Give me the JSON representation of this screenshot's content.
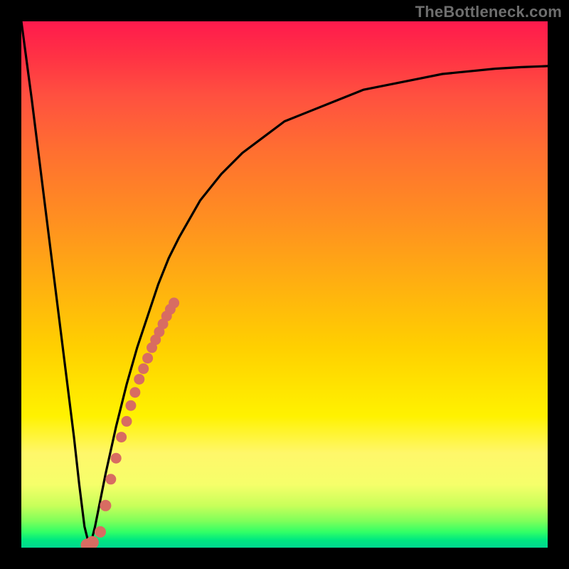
{
  "watermark": "TheBottleneck.com",
  "chart_data": {
    "type": "line",
    "title": "",
    "xlabel": "",
    "ylabel": "",
    "xlim": [
      0,
      100
    ],
    "ylim": [
      0,
      100
    ],
    "grid": false,
    "series": [
      {
        "name": "curve",
        "color": "#000000",
        "x": [
          0,
          2,
          4,
          6,
          8,
          10,
          11,
          12,
          13,
          14,
          16,
          18,
          20,
          22,
          24,
          26,
          28,
          30,
          34,
          38,
          42,
          46,
          50,
          55,
          60,
          65,
          70,
          75,
          80,
          85,
          90,
          95,
          100
        ],
        "y": [
          100,
          85,
          69,
          53,
          37,
          21,
          12,
          4,
          0,
          4,
          14,
          23,
          31,
          38,
          44,
          50,
          55,
          59,
          66,
          71,
          75,
          78,
          81,
          83,
          85,
          87,
          88,
          89,
          90,
          90.5,
          91,
          91.3,
          91.5
        ]
      },
      {
        "name": "highlight-dots",
        "color": "#d86c62",
        "x": [
          12.5,
          13.5,
          15,
          16,
          17,
          18,
          19,
          20,
          20.8,
          21.6,
          22.4,
          23.2,
          24,
          24.8,
          25.5,
          26.2,
          26.9,
          27.6,
          28.3,
          29
        ],
        "y": [
          0.5,
          1,
          3,
          8,
          13,
          17,
          21,
          24,
          27,
          29.5,
          32,
          34,
          36,
          38,
          39.5,
          41,
          42.5,
          44,
          45.3,
          46.5
        ]
      }
    ]
  }
}
